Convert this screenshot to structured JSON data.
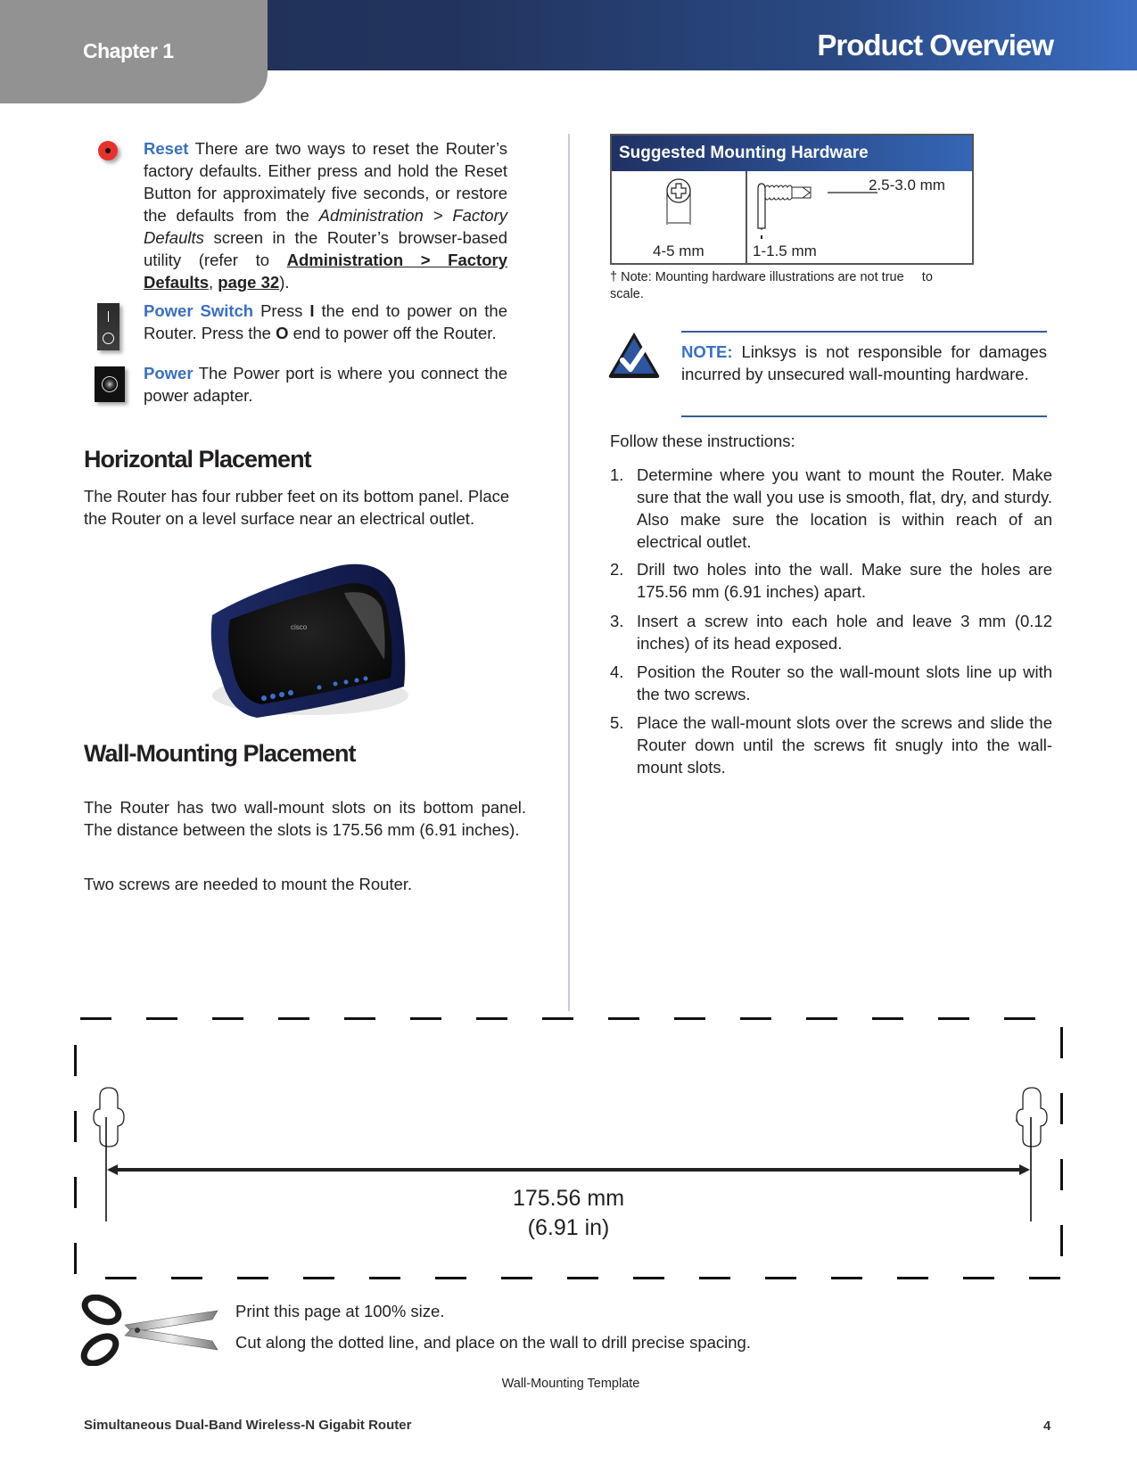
{
  "header": {
    "chapter": "Chapter 1",
    "title": "Product Overview",
    "gradient_colors": [
      "#1f2d55",
      "#3a6cc0"
    ],
    "tab_color": "#939292"
  },
  "left": {
    "reset": {
      "label": "Reset",
      "text_1": " There are two ways to reset the Router’s factory defaults. Either press and hold the Reset Button for approximately five seconds, or restore the defaults from the ",
      "italic": "Administration > Factory Defaults",
      "text_2": " screen in the Router’s browser-based utility (refer to ",
      "link_1": "Administration > Factory Defaults",
      "sep": ", ",
      "link_2": "page 32",
      "text_3": ")."
    },
    "power_switch": {
      "label": "Power Switch",
      "text_1": "  Press ",
      "bold_1": "I",
      "text_2": " the end to power on the Router. Press the ",
      "bold_2": "O",
      "text_3": " end to power off the Router."
    },
    "power": {
      "label": "Power",
      "text": "  The Power port is where you  connect the power adapter."
    },
    "horizontal": {
      "heading": "Horizontal Placement",
      "body": "The Router has four rubber feet on its bottom panel. Place the Router on a level surface near an electrical outlet."
    },
    "wall": {
      "heading": "Wall-Mounting Placement",
      "body_1": "The Router has two wall-mount slots on its bottom panel. The distance between the slots is 175.56 mm (6.91 inches).",
      "body_2": "Two screws are needed to mount the Router."
    }
  },
  "right": {
    "hardware": {
      "title": "Suggested Mounting Hardware",
      "head_diameter": "4-5 mm",
      "shaft_length": "2.5-3.0 mm",
      "head_thickness": "1-1.5 mm",
      "note": "†  Note: Mounting hardware illustrations are not true     to scale."
    },
    "note": {
      "label": "NOTE:",
      "text": " Linksys is not responsible for damages incurred by unsecured wall-mounting hardware."
    },
    "intro": "Follow these instructions:",
    "steps": [
      {
        "num": "1.",
        "text": "Determine where you want to mount the Router. Make sure that the wall you use is smooth, flat, dry, and sturdy. Also make sure the location is within reach of an electrical outlet."
      },
      {
        "num": "2.",
        "text": "Drill two holes into the wall. Make sure the holes are 175.56 mm (6.91 inches) apart."
      },
      {
        "num": "3.",
        "text": "Insert a screw into each hole and leave 3 mm (0.12 inches) of its head exposed."
      },
      {
        "num": "4.",
        "text": "Position the Router so the wall-mount slots line up with the two screws."
      },
      {
        "num": "5.",
        "text": "Place the wall-mount slots over the screws and slide the Router down until the screws fit snugly into the wall-mount slots."
      }
    ]
  },
  "template": {
    "distance_mm": "175.56 mm",
    "distance_in": "(6.91 in)",
    "print_instruction": "Print this page at 100% size.",
    "cut_instruction": "Cut along the dotted line, and place on the wall to drill precise spacing.",
    "caption": "Wall-Mounting Template"
  },
  "footer": {
    "product": "Simultaneous Dual-Band Wireless-N Gigabit Router",
    "page": "4"
  },
  "colors": {
    "accent_blue": "#3a6fc4",
    "reset_red": "#e8302c",
    "divider": "#c9ccd8"
  }
}
